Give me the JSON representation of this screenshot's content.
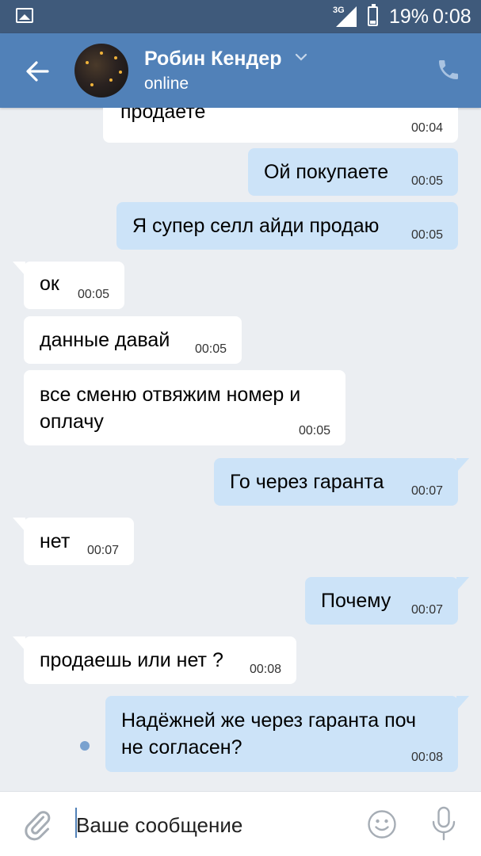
{
  "status_bar": {
    "network": "3G",
    "battery_pct_text": "19%",
    "battery_level": 0.19,
    "time": "0:08"
  },
  "header": {
    "contact_name": "Робин Кендер",
    "status": "online"
  },
  "messages": [
    {
      "dir": "in",
      "text": "продаете",
      "time": "00:04"
    },
    {
      "dir": "out",
      "text": "Ой покупаете",
      "time": "00:05"
    },
    {
      "dir": "out",
      "text": "Я супер селл айди продаю",
      "time": "00:05"
    },
    {
      "dir": "in",
      "text": "ок",
      "time": "00:05"
    },
    {
      "dir": "in",
      "text": "данные давай",
      "time": "00:05"
    },
    {
      "dir": "in",
      "lines": [
        "все сменю отвяжим номер и",
        "оплачу"
      ],
      "time": "00:05"
    },
    {
      "dir": "out",
      "text": "Го через гаранта",
      "time": "00:07"
    },
    {
      "dir": "in",
      "text": "нет",
      "time": "00:07"
    },
    {
      "dir": "out",
      "text": "Почему",
      "time": "00:07"
    },
    {
      "dir": "in",
      "text": "продаешь или нет ?",
      "time": "00:08"
    },
    {
      "dir": "out",
      "lines": [
        "Надёжней же через гаранта поч",
        "не согласен?"
      ],
      "time": "00:08"
    }
  ],
  "composer": {
    "placeholder": "Ваше сообщение"
  },
  "colors": {
    "status_bar": "#3f5a7b",
    "header": "#5181b8",
    "chat_bg": "#ebeef2",
    "bubble_out": "#cce3f8",
    "bubble_in": "#ffffff",
    "unread_dot": "#7aa2cf"
  },
  "icons": {
    "back": "arrow-left-icon",
    "call": "phone-icon",
    "attach": "paperclip-icon",
    "emoji": "smiley-icon",
    "mic": "microphone-icon"
  }
}
